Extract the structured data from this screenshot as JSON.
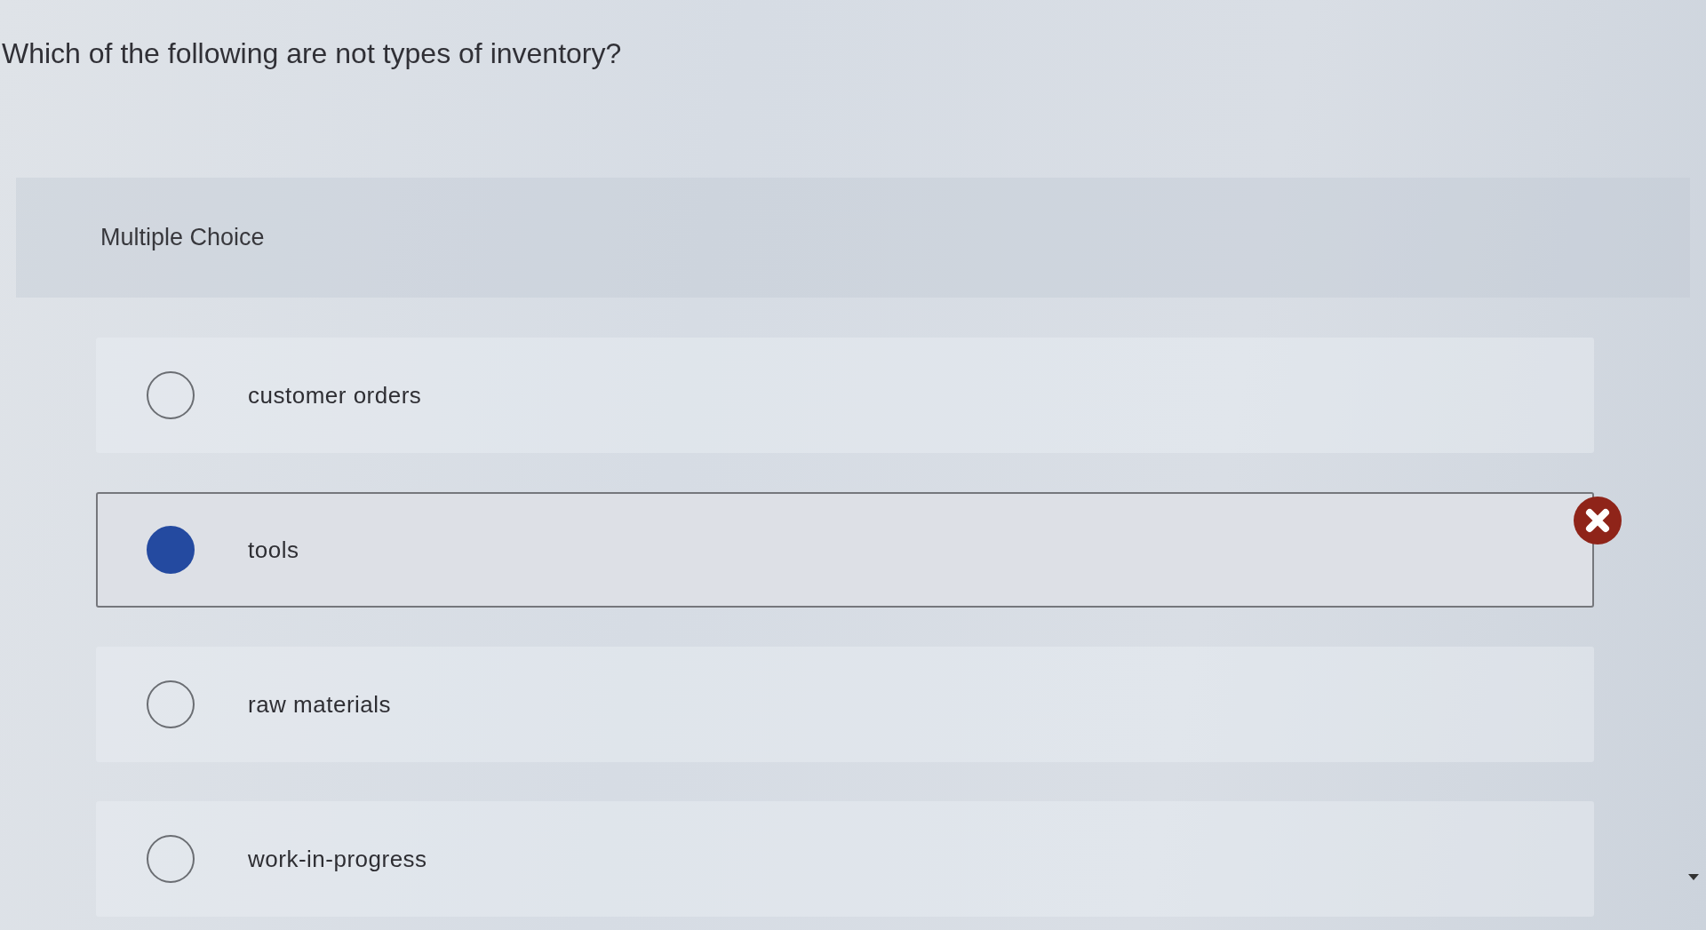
{
  "question": {
    "text": "Which of the following are not types of inventory?"
  },
  "question_type": {
    "label": "Multiple Choice"
  },
  "options": [
    {
      "label": "customer orders",
      "selected": false,
      "incorrect": false
    },
    {
      "label": "tools",
      "selected": true,
      "incorrect": true
    },
    {
      "label": "raw materials",
      "selected": false,
      "incorrect": false
    },
    {
      "label": "work-in-progress",
      "selected": false,
      "incorrect": false
    }
  ]
}
